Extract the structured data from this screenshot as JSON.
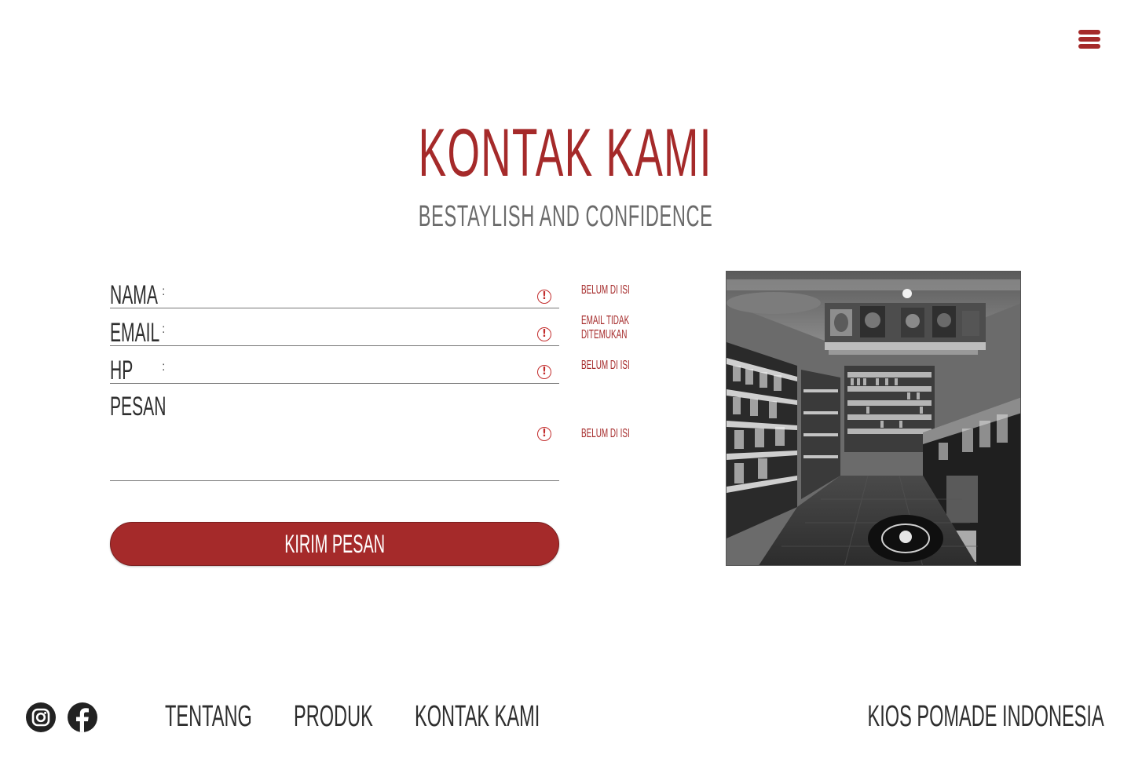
{
  "header": {
    "menu_icon": "hamburger-icon"
  },
  "page": {
    "title": "KONTAK KAMI",
    "subtitle": "BESTAYLISH AND CONFIDENCE"
  },
  "form": {
    "fields": {
      "nama": {
        "label": "NAMA",
        "colon": ":",
        "value": "",
        "error": "BELUM DI ISI"
      },
      "email": {
        "label": "EMAIL",
        "colon": ":",
        "value": "",
        "error": "EMAIL TIDAK DITEMUKAN"
      },
      "hp": {
        "label": "HP",
        "colon": ":",
        "value": "",
        "error": "BELUM DI ISI"
      },
      "pesan": {
        "label": "PESAN",
        "colon": ":",
        "value": "",
        "error": "BELUM DI ISI"
      }
    },
    "warning_icon": "exclamation-circle-icon",
    "submit_label": "KIRIM PESAN",
    "accent_color": "#a52a2a"
  },
  "photo": {
    "subject": "store-interior-photo"
  },
  "footer": {
    "social": [
      "instagram-icon",
      "facebook-icon"
    ],
    "nav": {
      "tentang": "TENTANG",
      "produk": "PRODUK",
      "kontak": "KONTAK KAMI"
    },
    "brand": "KIOS POMADE INDONESIA"
  }
}
